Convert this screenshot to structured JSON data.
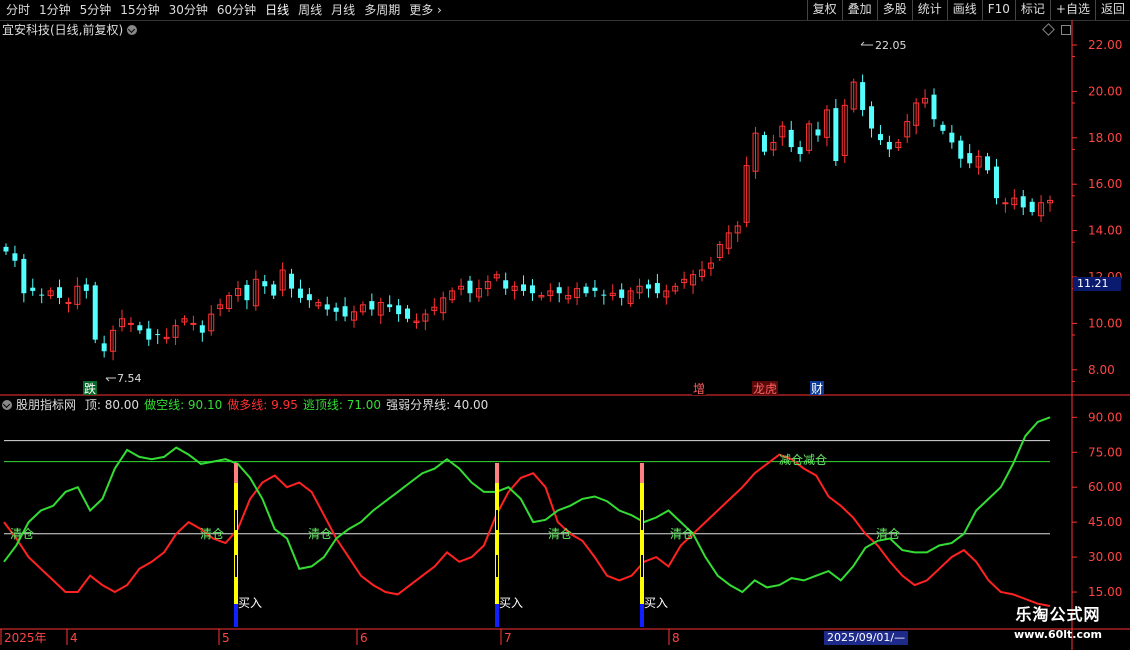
{
  "toolbar": {
    "periods": [
      "分时",
      "1分钟",
      "5分钟",
      "15分钟",
      "30分钟",
      "60分钟",
      "日线",
      "周线",
      "月线",
      "多周期",
      "更多"
    ],
    "active_period": "日线",
    "more_arrow": "›",
    "buttons": [
      "复权",
      "叠加",
      "多股",
      "统计",
      "画线",
      "F10",
      "标记",
      "+自选",
      "返回"
    ]
  },
  "main_panel": {
    "title": "宜安科技(日线,前复权)",
    "y_axis_labels": [
      "22.00",
      "20.00",
      "18.00",
      "16.00",
      "14.00",
      "12.00",
      "10.00",
      "8.00"
    ],
    "last_price": "11.21",
    "high_marker": "22.05",
    "low_marker": "7.54",
    "event_markers": [
      {
        "text": "跌",
        "color": "#ffffff",
        "bg": "#0a6a2a"
      },
      {
        "text": "增",
        "color": "#ff6060",
        "bg": "#000000"
      },
      {
        "text": "龙虎",
        "color": "#ff6060",
        "bg": "#5a0a0a"
      },
      {
        "text": "财",
        "color": "#ffffff",
        "bg": "#0a3a9a"
      }
    ]
  },
  "indicator_panel": {
    "name": "股朋指标网",
    "params": [
      {
        "label": "顶: 80.00",
        "color": "#dddddd"
      },
      {
        "label": "做空线: 90.10",
        "color": "#33dd33"
      },
      {
        "label": "做多线: 9.95",
        "color": "#ff3333"
      },
      {
        "label": "逃顶线: 71.00",
        "color": "#33dd33"
      },
      {
        "label": "强弱分界线: 40.00",
        "color": "#dddddd"
      }
    ],
    "y_axis_labels": [
      "90.00",
      "75.00",
      "60.00",
      "45.00",
      "30.00",
      "15.00"
    ],
    "labels": {
      "qingcang": "清仓",
      "jiancang": "减仓减仓",
      "mairu": "买入"
    }
  },
  "x_axis": {
    "labels": [
      "2025年",
      "4",
      "5",
      "6",
      "7",
      "8"
    ],
    "current_date": "2025/09/01/—"
  },
  "colors": {
    "up": "#ff3333",
    "down": "#54ffff",
    "axis": "#ff3333",
    "green_line": "#33dd33",
    "red_line": "#ff2222",
    "white_line": "#dddddd",
    "buy_yellow": "#ffff00",
    "buy_blue": "#1020ff",
    "buy_pink": "#ff8080"
  },
  "watermark": {
    "line1": "乐淘公式网",
    "line2": "www.60lt.com"
  }
}
